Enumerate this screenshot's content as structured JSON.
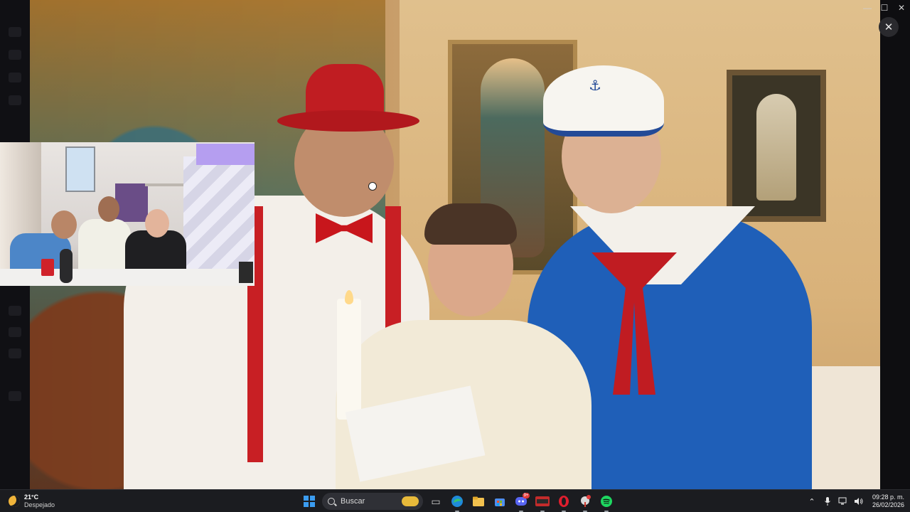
{
  "window": {
    "minimize_glyph": "—",
    "maximize_glyph": "☐",
    "close_glyph": "✕"
  },
  "viewer": {
    "close_glyph": "✕"
  },
  "taskbar": {
    "weather": {
      "temperature": "21°C",
      "condition": "Despejado",
      "icon": "moon-icon"
    },
    "search": {
      "placeholder": "Buscar"
    },
    "apps": [
      {
        "name": "task-view",
        "icon": "task-view-icon"
      },
      {
        "name": "edge",
        "icon": "edge-icon"
      },
      {
        "name": "file-explorer",
        "icon": "folder-icon"
      },
      {
        "name": "store",
        "icon": "store-icon"
      },
      {
        "name": "discord",
        "icon": "discord-icon",
        "badge": "9+"
      },
      {
        "name": "kick",
        "icon": "kick-icon"
      },
      {
        "name": "opera",
        "icon": "opera-icon"
      },
      {
        "name": "app-red",
        "icon": "app-icon"
      },
      {
        "name": "spotify",
        "icon": "spotify-icon"
      }
    ],
    "clock": {
      "time": "09:28 p. m.",
      "date": "26/02/2026"
    }
  },
  "colors": {
    "taskbar_bg": "#1b1c20",
    "accent_blue": "#3b9cf0",
    "badge_red": "#e23b3b"
  }
}
